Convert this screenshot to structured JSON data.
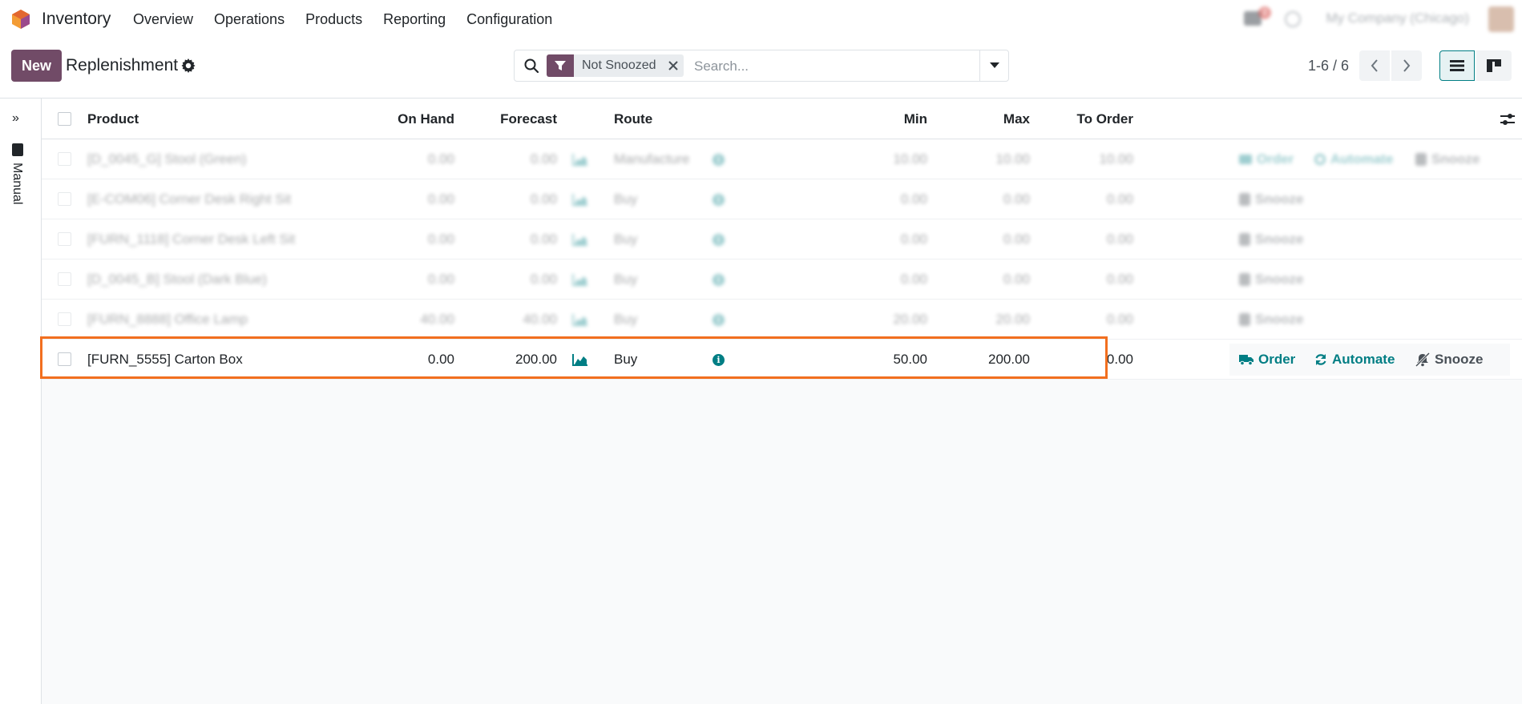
{
  "app": {
    "name": "Inventory",
    "menu": [
      "Overview",
      "Operations",
      "Products",
      "Reporting",
      "Configuration"
    ],
    "notification_count": "2",
    "company": "My Company (Chicago)"
  },
  "control_panel": {
    "new_label": "New",
    "title": "Replenishment",
    "search_facet": "Not Snoozed",
    "search_placeholder": "Search...",
    "pager": "1-6 / 6"
  },
  "side_panel": {
    "label": "Manual"
  },
  "table": {
    "columns": [
      "Product",
      "On Hand",
      "Forecast",
      "Route",
      "Min",
      "Max",
      "To Order"
    ],
    "rows": [
      {
        "product": "[D_0045_G] Stool (Green)",
        "on_hand": "0.00",
        "forecast": "0.00",
        "route": "Manufacture",
        "min": "10.00",
        "max": "10.00",
        "to_order": "10.00",
        "actions": [
          "Order",
          "Automate",
          "Snooze"
        ]
      },
      {
        "product": "[E-COM06] Corner Desk Right Sit",
        "on_hand": "0.00",
        "forecast": "0.00",
        "route": "Buy",
        "min": "0.00",
        "max": "0.00",
        "to_order": "0.00",
        "actions": [
          "Snooze"
        ]
      },
      {
        "product": "[FURN_1118] Corner Desk Left Sit",
        "on_hand": "0.00",
        "forecast": "0.00",
        "route": "Buy",
        "min": "0.00",
        "max": "0.00",
        "to_order": "0.00",
        "actions": [
          "Snooze"
        ]
      },
      {
        "product": "[D_0045_B] Stool (Dark Blue)",
        "on_hand": "0.00",
        "forecast": "0.00",
        "route": "Buy",
        "min": "0.00",
        "max": "0.00",
        "to_order": "0.00",
        "actions": [
          "Snooze"
        ]
      },
      {
        "product": "[FURN_8888] Office Lamp",
        "on_hand": "40.00",
        "forecast": "40.00",
        "route": "Buy",
        "min": "20.00",
        "max": "20.00",
        "to_order": "0.00",
        "actions": [
          "Snooze"
        ]
      },
      {
        "product": "[FURN_5555] Carton Box",
        "on_hand": "0.00",
        "forecast": "200.00",
        "route": "Buy",
        "min": "50.00",
        "max": "200.00",
        "to_order": "0.00",
        "actions": [
          "Order",
          "Automate",
          "Snooze"
        ]
      }
    ]
  },
  "colors": {
    "brand": "#714b67",
    "accent": "#017e84",
    "highlight": "#f26f1f"
  }
}
